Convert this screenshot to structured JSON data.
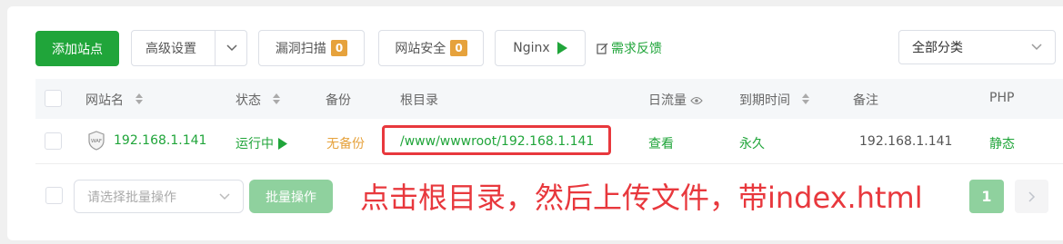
{
  "toolbar": {
    "add_site": "添加站点",
    "advanced": "高级设置",
    "vuln_scan": "漏洞扫描",
    "vuln_count": "0",
    "site_security": "网站安全",
    "security_count": "0",
    "nginx": "Nginx",
    "feedback": "需求反馈",
    "category": "全部分类"
  },
  "table": {
    "headers": [
      "网站名",
      "状态",
      "备份",
      "根目录",
      "日流量",
      "到期时间",
      "备注",
      "PHP"
    ],
    "row": {
      "waf_label": "WAF",
      "name": "192.168.1.141",
      "status": "运行中",
      "backup": "无备份",
      "root": "/www/wwwroot/192.168.1.141",
      "traffic": "查看",
      "expire": "永久",
      "remark": "192.168.1.141",
      "php": "静态"
    }
  },
  "footer": {
    "batch_placeholder": "请选择批量操作",
    "batch_button": "批量操作",
    "page": "1"
  },
  "annotation": "点击根目录，然后上传文件，带index.html",
  "colors": {
    "accent": "#20a53a",
    "warning": "#e6a23c",
    "annotation": "#e8383d"
  }
}
